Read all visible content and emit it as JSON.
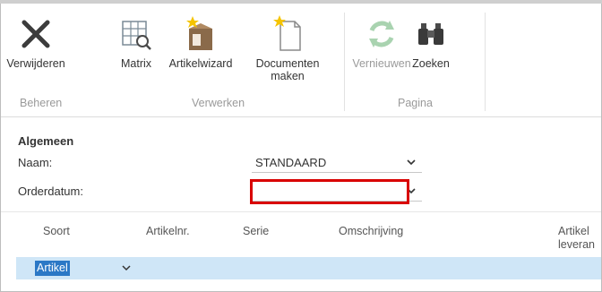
{
  "ribbon": {
    "groups": {
      "beheren": "Beheren",
      "verwerken": "Verwerken",
      "pagina": "Pagina"
    },
    "buttons": {
      "verwijderen": "Verwijderen",
      "matrix": "Matrix",
      "artikelwizard": "Artikelwizard",
      "documenten_line1": "Documenten",
      "documenten_line2": "maken",
      "vernieuwen": "Vernieuwen",
      "zoeken": "Zoeken"
    },
    "vernieuwen_disabled": true
  },
  "form": {
    "section_title": "Algemeen",
    "naam_label": "Naam:",
    "naam_value": "STANDAARD",
    "orderdatum_label": "Orderdatum:",
    "orderdatum_value": ""
  },
  "grid": {
    "columns": [
      "Soort",
      "Artikelnr.",
      "Serie",
      "Omschrijving",
      "Artikel",
      "leveran"
    ],
    "rows": [
      {
        "soort": "Artikel"
      }
    ]
  },
  "colors": {
    "highlight_border": "#d90000",
    "row_selected": "#cfe6f7",
    "edit_selection": "#2b78c6"
  },
  "icons": [
    "close-icon",
    "matrix-icon",
    "wizard-box-icon",
    "new-document-icon",
    "refresh-icon",
    "binoculars-icon",
    "chevron-down-icon"
  ]
}
